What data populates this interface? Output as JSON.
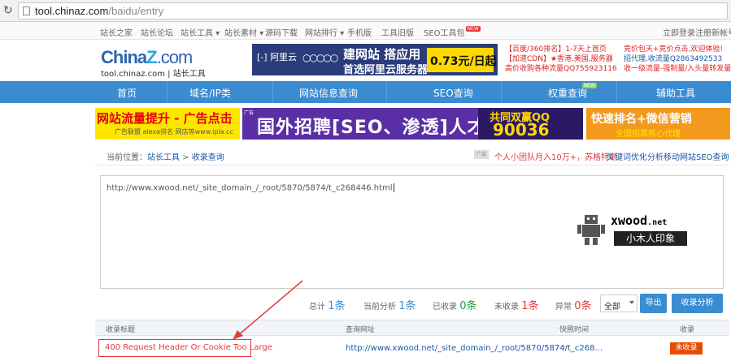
{
  "browser": {
    "url_host": "tool.chinaz.com",
    "url_path": "/baidu/entry"
  },
  "topnav": {
    "items": [
      "站长之家",
      "站长论坛",
      "站长工具",
      "站长素材",
      "源码下载",
      "网站排行",
      "手机版",
      "工具旧版",
      "SEO工具包"
    ],
    "new_badge": "NEW",
    "login": "立即登录",
    "register": "注册新帐号"
  },
  "logo": {
    "brand_a": "China",
    "brand_z": "Z",
    "brand_c": ".com",
    "sub": "tool.chinaz.com | 站长工具"
  },
  "ad_aliyun": {
    "brand": "阿里云",
    "line1": "建网站 搭应用",
    "line2": "首选阿里云服务器",
    "price": "0.73元/日起"
  },
  "side_ads": {
    "c1_l1": "【百度/360排名】1-7天上首页",
    "c1_l2": "【加速CDN】★香港,美国,服务器",
    "c1_l3": "高价收购各种流量QQ755923116",
    "c2_l1": "竞价包天+竞价点击,欢迎体验!",
    "c2_l2": "招代理,收流量Q2863492533",
    "c2_l3": "收一级流量-强制量/入头量转发量"
  },
  "mainnav": {
    "items": [
      "首页",
      "域名/IP类",
      "网站信息查询",
      "SEO查询",
      "权重查询",
      "辅助工具"
    ],
    "new_badge": "NEW"
  },
  "banners": {
    "b1_big": "网站流量提升 - 广告点击",
    "b1_small": "广告联盟 alexa排名 网店等www.ipla.cc",
    "b2_tag": "广告",
    "b2_big": "国外招聘[SEO、渗透]人才",
    "b2_qq_top": "共同双赢QQ",
    "b2_qq_num": "90036",
    "b3_big": "快速排名+微信营销",
    "b3_small": "全国招募核心代理"
  },
  "breadcrumb": {
    "prefix": "当前位置：",
    "l1": "站长工具",
    "sep": " > ",
    "l2": "收录查询",
    "ad_tag": "广告",
    "r1": "个人小团队月入10万+，苏格特训",
    "r2": "关键词优化分析",
    "r3": "移动网站SEO查询"
  },
  "input": {
    "value": "http://www.xwood.net/_site_domain_/_root/5870/5874/t_c268446.html"
  },
  "watermark": {
    "brand": "xwood",
    "tld": ".net",
    "cn": "小木人印象"
  },
  "stats": {
    "total_label": "总计",
    "total_val": "1条",
    "analyzing_label": "当前分析",
    "analyzing_val": "1条",
    "indexed_label": "已收录",
    "indexed_val": "0条",
    "unindexed_label": "未收录",
    "unindexed_val": "1条",
    "error_label": "异常",
    "error_val": "0条",
    "filter_value": "全部",
    "export_btn": "导出",
    "analyze_btn": "收录分析"
  },
  "table": {
    "headers": [
      "收录标题",
      "查询网址",
      "快照时间",
      "收录"
    ],
    "rows": [
      {
        "title": "400 Request Header Or Cookie Too Large",
        "url": "http://www.xwood.net/_site_domain_/_root/5870/5874/t_c268...",
        "snapshot": "--",
        "status": "未收录"
      }
    ]
  },
  "colors": {
    "nav_blue": "#3b8bd1",
    "red": "#e4393c",
    "status_orange": "#e74c00"
  }
}
